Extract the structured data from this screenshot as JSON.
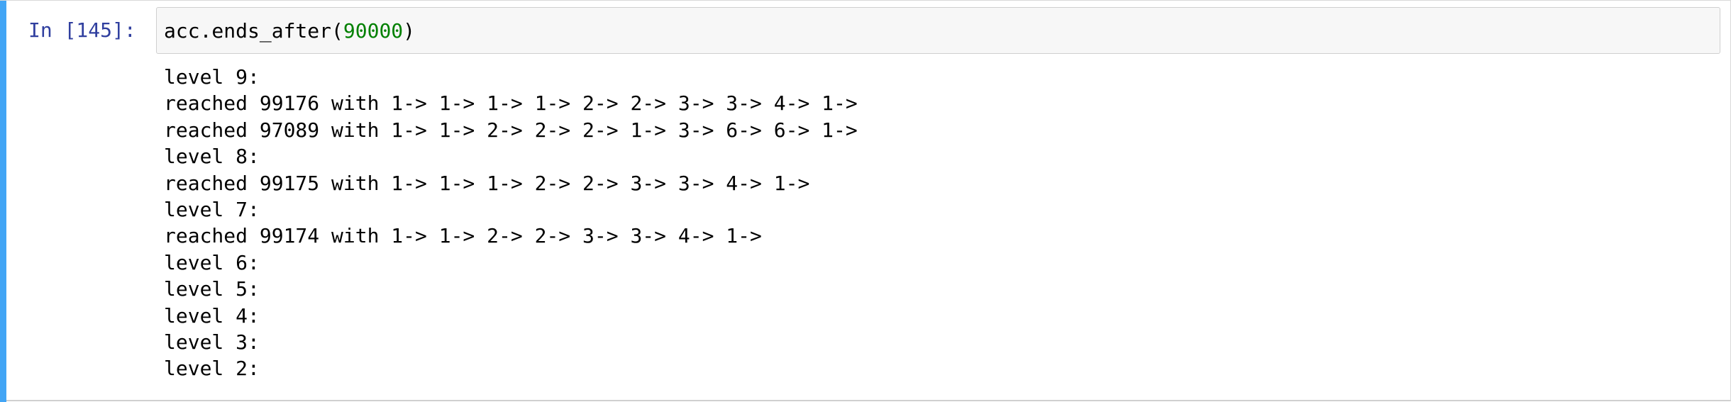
{
  "cell": {
    "prompt": "In [145]:",
    "code": {
      "prefix": "acc.ends_after(",
      "argument": "90000",
      "suffix": ")"
    },
    "output_lines": [
      "level 9:",
      "reached 99176 with 1-> 1-> 1-> 1-> 2-> 2-> 3-> 3-> 4-> 1->",
      "reached 97089 with 1-> 1-> 2-> 2-> 2-> 1-> 3-> 6-> 6-> 1->",
      "level 8:",
      "reached 99175 with 1-> 1-> 1-> 2-> 2-> 3-> 3-> 4-> 1->",
      "level 7:",
      "reached 99174 with 1-> 1-> 2-> 2-> 3-> 3-> 4-> 1->",
      "level 6:",
      "level 5:",
      "level 4:",
      "level 3:",
      "level 2:"
    ]
  },
  "colors": {
    "prompt": "#303f9f",
    "number_literal": "#008000",
    "selected_cell_bar": "#42a5f5",
    "input_background": "#f7f7f7"
  }
}
